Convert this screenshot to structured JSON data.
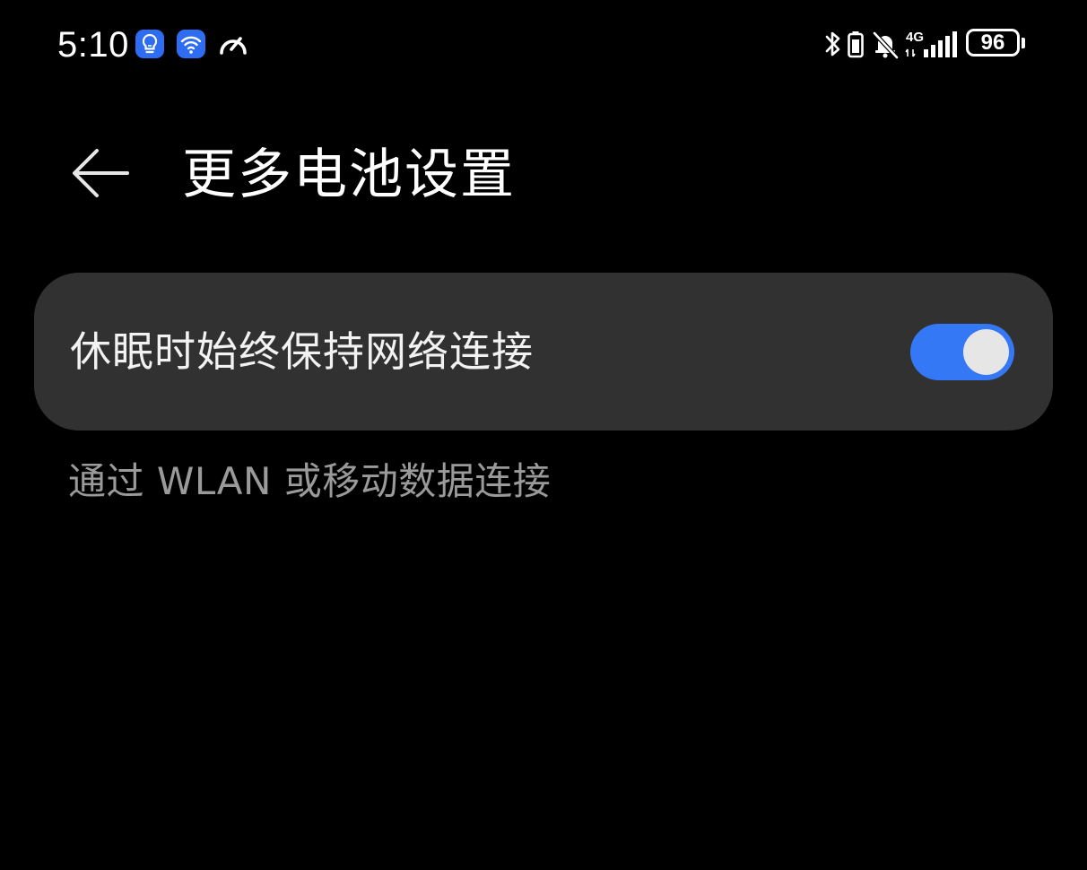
{
  "status_bar": {
    "time": "5:10",
    "notification_icons": [
      "lightbulb-app-icon",
      "wifi-app-icon",
      "speedometer-icon"
    ],
    "system_icons": [
      "bluetooth-icon",
      "battery-saver-icon",
      "bell-muted-icon",
      "signal-4g-icon"
    ],
    "network_type": "4G",
    "battery_level": "96"
  },
  "header": {
    "back_icon": "arrow-left-icon",
    "title": "更多电池设置"
  },
  "setting": {
    "label": "休眠时始终保持网络连接",
    "enabled": true,
    "description": "通过 WLAN 或移动数据连接"
  },
  "colors": {
    "background": "#000000",
    "card": "#313131",
    "toggle_on": "#3478f6",
    "description_text": "#9a9a9a"
  }
}
